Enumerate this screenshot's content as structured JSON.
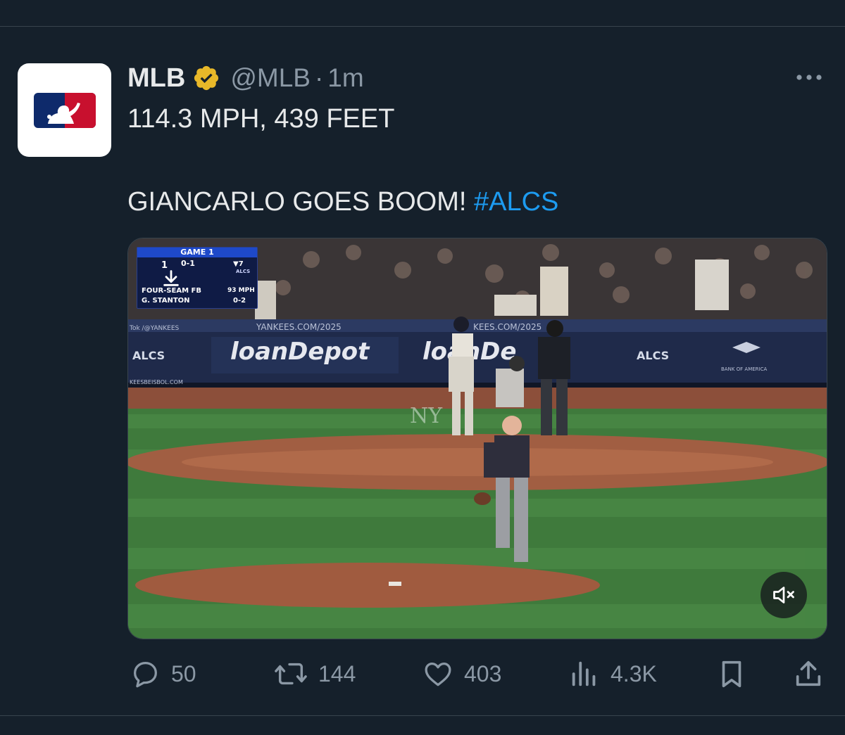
{
  "tweet": {
    "author_name": "MLB",
    "handle": "@MLB",
    "separator": "·",
    "time": "1m",
    "text_line1": "114.3 MPH, 439 FEET",
    "text_line2": "GIANCARLO GOES BOOM!",
    "hashtag": "#ALCS"
  },
  "media": {
    "type": "video",
    "scorebug": {
      "game_label": "GAME 1",
      "score": "1",
      "count": "0-1",
      "inning": "▼7",
      "series_note": "ALCS",
      "pitch_type": "FOUR-SEAM FB",
      "batter": "G. STANTON",
      "pitch_speed": "93 MPH",
      "batter_record": "0-2"
    },
    "signage": {
      "left_url": "YANKEES.COM/2025",
      "right_url": "KEES.COM/2025",
      "sponsor": "loanDepot",
      "left_badge": "ALCS",
      "bank": "BANK OF AMERICA",
      "tok_tag": "Tok /@YANKEES",
      "beisbol": "KEESBEISBOL.COM"
    },
    "muted": true
  },
  "actions": {
    "replies": "50",
    "reposts": "144",
    "likes": "403",
    "views": "4.3K"
  },
  "colors": {
    "background": "#15202b",
    "text_primary": "#e7e9ea",
    "text_secondary": "#8b98a5",
    "link": "#1d9bf0",
    "verified_badge": "#e8b829",
    "divider": "#38444d"
  },
  "icons": {
    "avatar": "mlb-logo",
    "verified": "verified-badge-icon",
    "more": "more-icon",
    "reply": "reply-icon",
    "repost": "repost-icon",
    "like": "heart-icon",
    "views": "views-icon",
    "bookmark": "bookmark-icon",
    "share": "share-icon",
    "mute": "mute-icon",
    "download": "download-icon"
  }
}
